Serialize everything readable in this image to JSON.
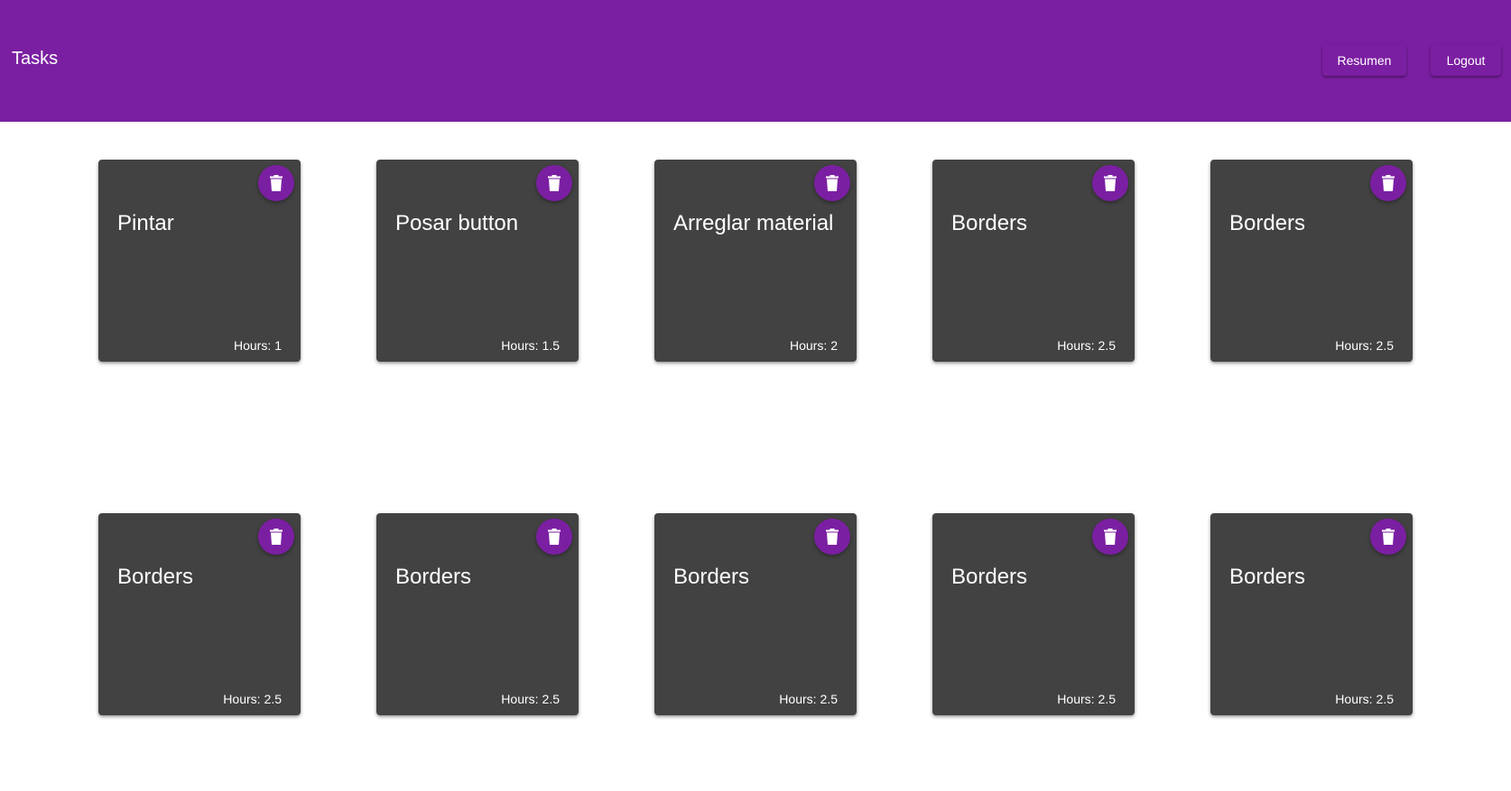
{
  "toolbar": {
    "title": "Tasks",
    "resumen_label": "Resumen",
    "logout_label": "Logout"
  },
  "colors": {
    "primary": "#7b1fa2",
    "card_background": "#424242"
  },
  "hours_label": "Hours:",
  "delete_icon": "trash-icon",
  "tasks": [
    {
      "title": "Pintar",
      "hours": "1"
    },
    {
      "title": "Posar button",
      "hours": "1.5"
    },
    {
      "title": "Arreglar material",
      "hours": "2"
    },
    {
      "title": "Borders",
      "hours": "2.5"
    },
    {
      "title": "Borders",
      "hours": "2.5"
    },
    {
      "title": "Borders",
      "hours": "2.5"
    },
    {
      "title": "Borders",
      "hours": "2.5"
    },
    {
      "title": "Borders",
      "hours": "2.5"
    },
    {
      "title": "Borders",
      "hours": "2.5"
    },
    {
      "title": "Borders",
      "hours": "2.5"
    }
  ]
}
